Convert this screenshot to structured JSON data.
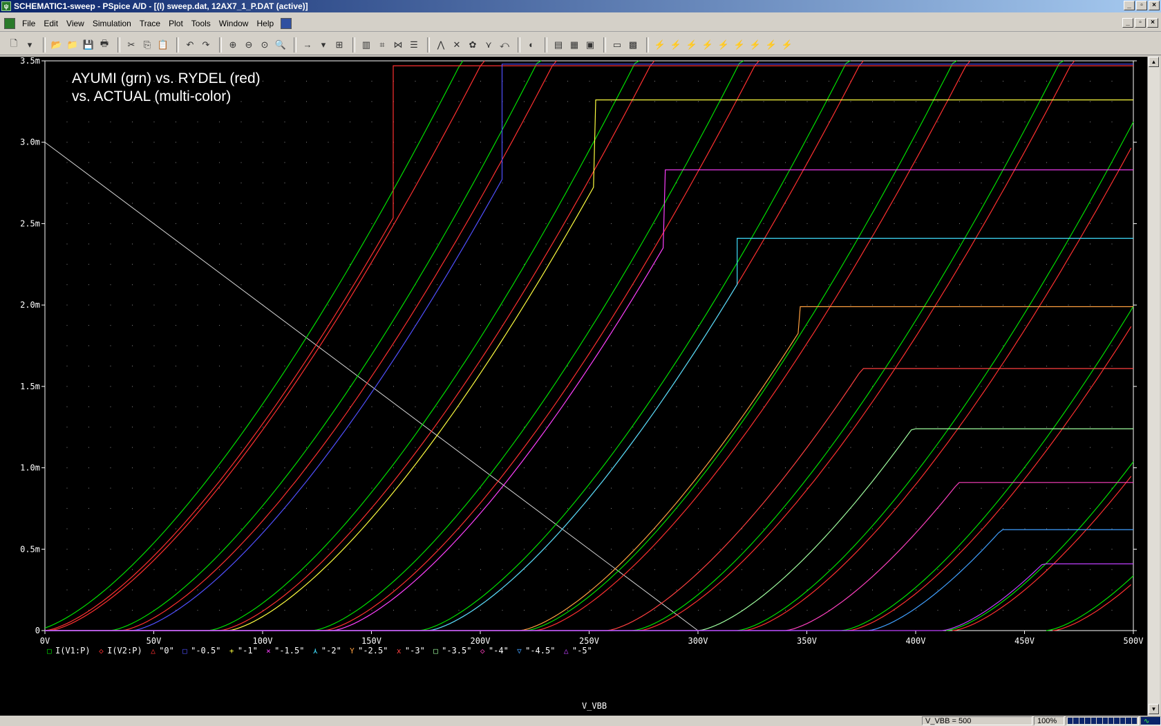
{
  "window": {
    "title": "SCHEMATIC1-sweep - PSpice A/D  - [(I) sweep.dat, 12AX7_1_P.DAT (active)]",
    "app_icon_glyph": "ψ",
    "min_glyph": "_",
    "max_glyph": "▫",
    "close_glyph": "×"
  },
  "menu": {
    "items": [
      "File",
      "Edit",
      "View",
      "Simulation",
      "Trace",
      "Plot",
      "Tools",
      "Window",
      "Help"
    ]
  },
  "toolbar": {
    "icons": [
      "new-icon",
      "dropdown-icon",
      "|",
      "open-icon",
      "open-folder-icon",
      "save-icon",
      "print-icon",
      "|",
      "cut-icon",
      "copy-icon",
      "paste-icon",
      "|",
      "undo-icon",
      "redo-icon",
      "|",
      "zoom-in-icon",
      "zoom-out-icon",
      "zoom-area-icon",
      "zoom-fit-icon",
      "|",
      "arrow-icon",
      "dropdown-icon",
      "log-icon",
      "|",
      "fourier-icon",
      "performance-icon",
      "xy-icon",
      "table-icon",
      "|",
      "add-trace-icon",
      "toggle-cursor-icon",
      "color-icon",
      "peak-icon",
      "trough-icon",
      "|",
      "mark-label-icon",
      "|",
      "view-netlist-icon",
      "view-output-icon",
      "save-plot-icon",
      "|",
      "run-icon",
      "settings-icon",
      "|",
      "marker-voltage-icon",
      "marker-current-icon",
      "marker-power-icon",
      "marker-diff-icon",
      "marker-db-icon",
      "marker-phase-icon",
      "marker-group-icon",
      "marker-real-icon",
      "marker-imag-icon"
    ],
    "glyphs": {
      "new-icon": "🗋",
      "dropdown-icon": "▾",
      "open-icon": "📂",
      "open-folder-icon": "📁",
      "save-icon": "💾",
      "print-icon": "🖶",
      "cut-icon": "✂",
      "copy-icon": "⎘",
      "paste-icon": "📋",
      "undo-icon": "↶",
      "redo-icon": "↷",
      "zoom-in-icon": "⊕",
      "zoom-out-icon": "⊖",
      "zoom-area-icon": "⊙",
      "zoom-fit-icon": "🔍",
      "arrow-icon": "→",
      "log-icon": "⊞",
      "fourier-icon": "▥",
      "performance-icon": "⌗",
      "xy-icon": "⋈",
      "table-icon": "☰",
      "add-trace-icon": "⋀",
      "toggle-cursor-icon": "✕",
      "color-icon": "✿",
      "peak-icon": "⋎",
      "trough-icon": "⤺",
      "mark-label-icon": "◐",
      "view-netlist-icon": "▤",
      "view-output-icon": "▦",
      "save-plot-icon": "▣",
      "run-icon": "▭",
      "settings-icon": "▩",
      "marker-voltage-icon": "⚡",
      "marker-current-icon": "⚡",
      "marker-power-icon": "⚡",
      "marker-diff-icon": "⚡",
      "marker-db-icon": "⚡",
      "marker-phase-icon": "⚡",
      "marker-group-icon": "⚡",
      "marker-real-icon": "⚡",
      "marker-imag-icon": "⚡"
    }
  },
  "annotation": {
    "line1": "AYUMI (grn) vs. RYDEL (red)",
    "line2": "vs. ACTUAL (multi-color)"
  },
  "status": {
    "sweep_readout": "V_VBB = 500",
    "zoom": "100%",
    "progress": 1.0
  },
  "colors": {
    "background": "#000000",
    "axis": "#ffffff",
    "grid_dots": "#8a8a8a",
    "ayumi_green": "#00e000",
    "rydel_red": "#ff3030",
    "load_line": "#d8d8d8"
  },
  "chart_data": {
    "type": "line",
    "xlabel": "V_VBB",
    "ylabel": "",
    "xlim": [
      0,
      500
    ],
    "ylim": [
      0,
      3.5
    ],
    "y_unit": "mA",
    "xticks": [
      0,
      50,
      100,
      150,
      200,
      250,
      300,
      350,
      400,
      450,
      500
    ],
    "xtick_labels": [
      "0V",
      "50V",
      "100V",
      "150V",
      "200V",
      "250V",
      "300V",
      "350V",
      "400V",
      "450V",
      "500V"
    ],
    "yticks": [
      0,
      0.5,
      1.0,
      1.5,
      2.0,
      2.5,
      3.0,
      3.5
    ],
    "ytick_labels": [
      "0",
      "0.5m",
      "1.0m",
      "1.5m",
      "2.0m",
      "2.5m",
      "3.0m",
      "3.5m"
    ],
    "grid": true,
    "legend": {
      "placement": "bottom",
      "entries": [
        {
          "symbol": "□",
          "label": "I(V1:P)",
          "color": "#00e000"
        },
        {
          "symbol": "◇",
          "label": "I(V2:P)",
          "color": "#ff3030"
        },
        {
          "symbol": "△",
          "label": "\"0\"",
          "color": "#ff3030"
        },
        {
          "symbol": "□",
          "label": "\"-0.5\"",
          "color": "#5050ff"
        },
        {
          "symbol": "+",
          "label": "\"-1\"",
          "color": "#ffff40"
        },
        {
          "symbol": "×",
          "label": "\"-1.5\"",
          "color": "#ff40ff"
        },
        {
          "symbol": "⋏",
          "label": "\"-2\"",
          "color": "#40e0ff"
        },
        {
          "symbol": "Y",
          "label": "\"-2.5\"",
          "color": "#ffa040"
        },
        {
          "symbol": "x",
          "label": "\"-3\"",
          "color": "#ff4040"
        },
        {
          "symbol": "□",
          "label": "\"-3.5\"",
          "color": "#a0ffa0"
        },
        {
          "symbol": "◇",
          "label": "\"-4\"",
          "color": "#ff40c0"
        },
        {
          "symbol": "▽",
          "label": "\"-4.5\"",
          "color": "#40a0ff"
        },
        {
          "symbol": "△",
          "label": "\"-5\"",
          "color": "#c040ff"
        }
      ]
    },
    "load_line": {
      "x": [
        0,
        300
      ],
      "y": [
        3.0,
        0
      ],
      "color": "#d8d8d8"
    },
    "model_curves": {
      "ayumi_offsets": [
        -5,
        30,
        75,
        123,
        172,
        221,
        270,
        318,
        366,
        414,
        460
      ],
      "rydel_offsets": [
        2,
        35,
        80,
        128,
        176,
        225,
        273,
        321,
        369,
        417,
        463
      ]
    },
    "series": [
      {
        "name": "\"0\"",
        "color": "#ff3030",
        "offset": 0,
        "sat_x": 160,
        "sat_y": 3.47
      },
      {
        "name": "\"-0.5\"",
        "color": "#5050ff",
        "offset": 40,
        "sat_x": 210,
        "sat_y": 3.48
      },
      {
        "name": "\"-1\"",
        "color": "#ffff40",
        "offset": 84,
        "sat_x": 253,
        "sat_y": 3.26
      },
      {
        "name": "\"-1.5\"",
        "color": "#ff40ff",
        "offset": 132,
        "sat_x": 285,
        "sat_y": 2.83
      },
      {
        "name": "\"-2\"",
        "color": "#40e0ff",
        "offset": 176,
        "sat_x": 318,
        "sat_y": 2.41
      },
      {
        "name": "\"-2.5\"",
        "color": "#ffa040",
        "offset": 218,
        "sat_x": 347,
        "sat_y": 1.99
      },
      {
        "name": "\"-3\"",
        "color": "#ff4040",
        "offset": 258,
        "sat_x": 378,
        "sat_y": 1.61
      },
      {
        "name": "\"-3.5\"",
        "color": "#a0ffa0",
        "offset": 300,
        "sat_x": 405,
        "sat_y": 1.24
      },
      {
        "name": "\"-4\"",
        "color": "#ff40c0",
        "offset": 340,
        "sat_x": 427,
        "sat_y": 0.91
      },
      {
        "name": "\"-4.5\"",
        "color": "#40a0ff",
        "offset": 378,
        "sat_x": 451,
        "sat_y": 0.62
      },
      {
        "name": "\"-5\"",
        "color": "#c040ff",
        "offset": 412,
        "sat_x": 470,
        "sat_y": 0.41
      }
    ]
  }
}
